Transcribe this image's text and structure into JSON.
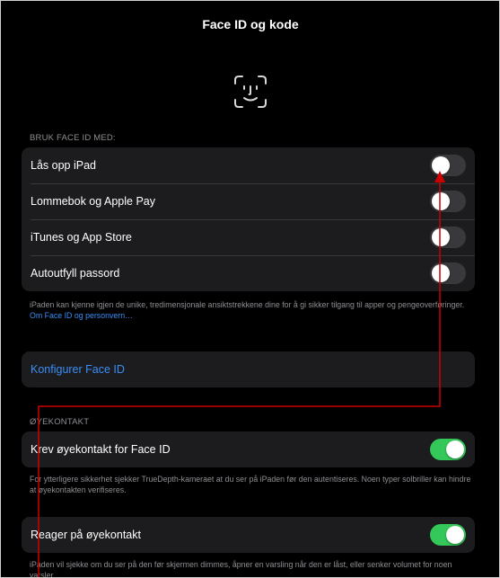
{
  "nav": {
    "title": "Face ID og kode"
  },
  "section1": {
    "header": "BRUK FACE ID MED:",
    "items": [
      {
        "label": "Lås opp iPad",
        "on": false
      },
      {
        "label": "Lommebok og Apple Pay",
        "on": false
      },
      {
        "label": "iTunes og App Store",
        "on": false
      },
      {
        "label": "Autoutfyll passord",
        "on": false
      }
    ],
    "footer_text": "iPaden kan kjenne igjen de unike, tredimensjonale ansiktstrekkene dine for å gi sikker tilgang til apper og pengeoverføringer.",
    "footer_link": "Om Face ID og personvern…"
  },
  "configure": {
    "label": "Konfigurer Face ID"
  },
  "section2": {
    "header": "ØYEKONTAKT",
    "require_label": "Krev øyekontakt for Face ID",
    "require_on": true,
    "require_footer": "For ytterligere sikkerhet sjekker TrueDepth-kameraet at du ser på iPaden før den autentiseres. Noen typer solbriller kan hindre at øyekontakten verifiseres.",
    "react_label": "Reager på øyekontakt",
    "react_on": true,
    "react_footer": "iPaden vil sjekke om du ser på den før skjermen dimmes, åpner en varsling når den er låst, eller senker volumet for noen varsler."
  },
  "colors": {
    "background": "#000000",
    "cell": "#1c1c1e",
    "toggle_on": "#34c759",
    "toggle_off": "#39393d",
    "link": "#3a8ef6",
    "annotation": "#cc0000"
  },
  "icons": {
    "faceid": "faceid-icon",
    "annotation_arrow": "arrow-up-icon"
  }
}
